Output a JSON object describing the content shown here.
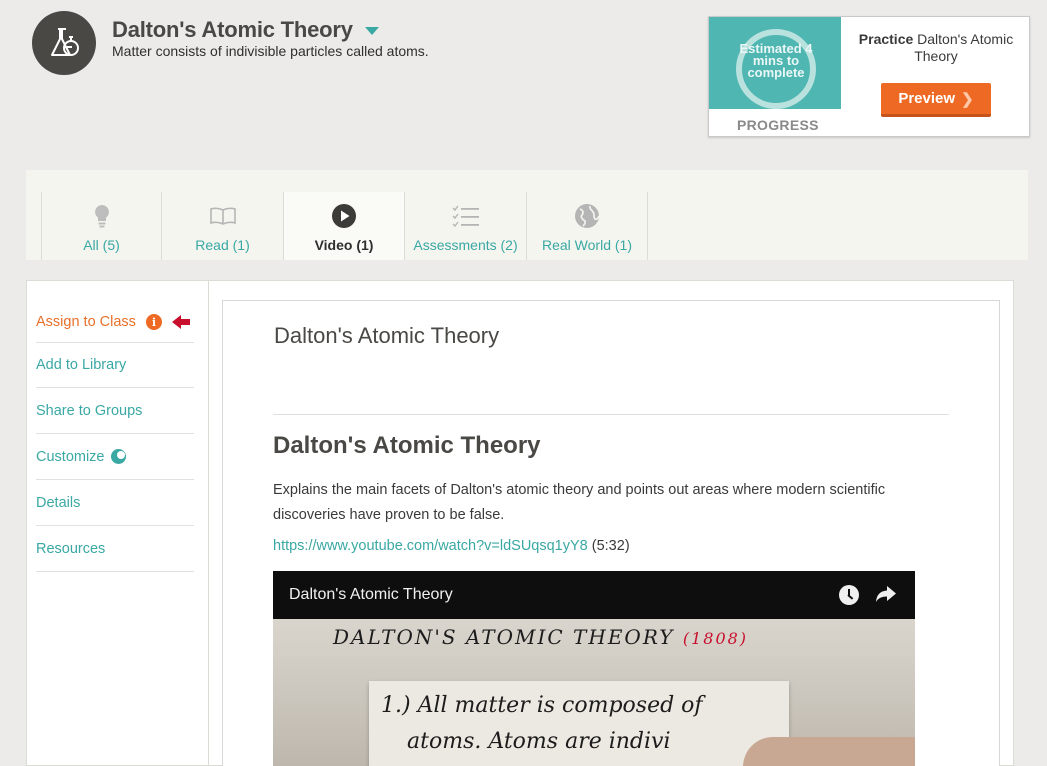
{
  "header": {
    "title": "Dalton's Atomic Theory",
    "subtitle": "Matter consists of indivisible particles called atoms.",
    "icon": "flask-icon"
  },
  "practice": {
    "estimate_text": "Estimated 4 mins to complete",
    "progress_label": "PROGRESS",
    "practice_bold": "Practice",
    "practice_rest": "Dalton's Atomic Theory",
    "preview_label": "Preview",
    "button_color": "#ee6a24"
  },
  "tabs": [
    {
      "label": "All (5)",
      "icon": "lightbulb-icon"
    },
    {
      "label": "Read (1)",
      "icon": "book-icon"
    },
    {
      "label": "Video (1)",
      "icon": "play-icon",
      "active": true
    },
    {
      "label": "Assessments (2)",
      "icon": "checklist-icon"
    },
    {
      "label": "Real World (1)",
      "icon": "globe-icon"
    }
  ],
  "sidebar": {
    "items": [
      {
        "label": "Assign to Class"
      },
      {
        "label": "Add to Library"
      },
      {
        "label": "Share to Groups"
      },
      {
        "label": "Customize"
      },
      {
        "label": "Details"
      },
      {
        "label": "Resources"
      }
    ]
  },
  "content": {
    "page_title": "Dalton's Atomic Theory",
    "heading": "Dalton's Atomic Theory",
    "description": "Explains the main facets of Dalton's atomic theory and points out areas where modern scientific discoveries have proven to be false.",
    "link": "https://www.youtube.com/watch?v=ldSUqsq1yY8",
    "duration": "(5:32)"
  },
  "video": {
    "title": "Dalton's Atomic Theory",
    "frame_heading": "DALTON'S ATOMIC THEORY",
    "frame_year": "(1808)",
    "frame_line1": "1.) All matter is composed of",
    "frame_line2": "atoms. Atoms are indivi"
  },
  "colors": {
    "accent_teal": "#3aa8a3",
    "accent_orange": "#e8702a",
    "arrow_red": "#c8102e"
  }
}
